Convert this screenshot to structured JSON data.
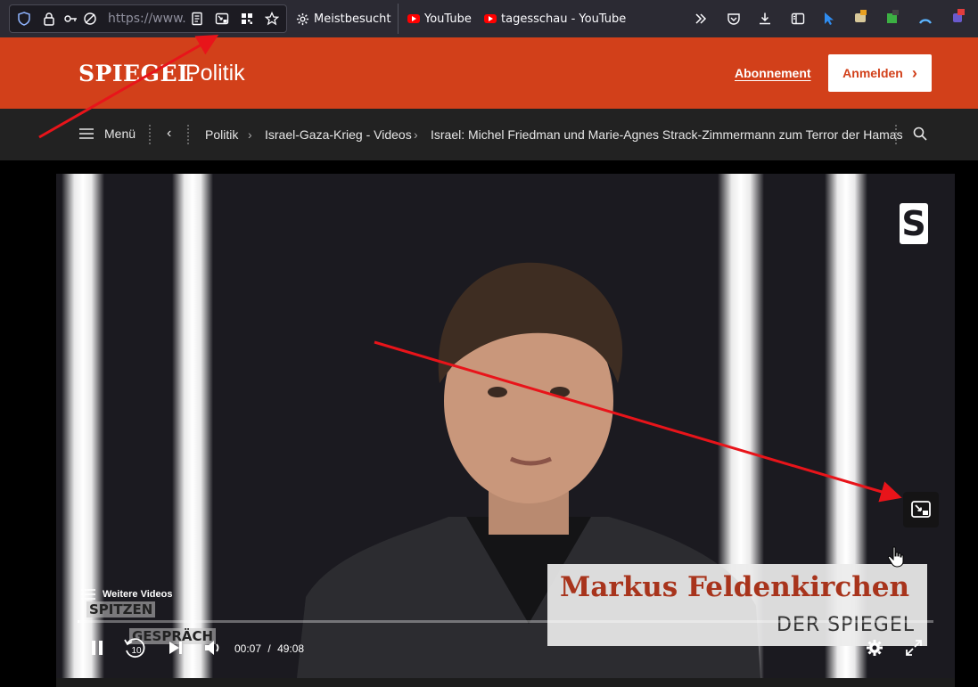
{
  "browser": {
    "url_text": "https://www.",
    "bookmarks": [
      {
        "label": "Meistbesucht",
        "icon": "gear-icon"
      },
      {
        "label": "YouTube",
        "icon": "youtube-icon"
      },
      {
        "label": "tagesschau - YouTube",
        "icon": "youtube-icon"
      }
    ]
  },
  "header": {
    "logo": "SPIEGEL",
    "section": "Politik",
    "subscribe_label": "Abonnement",
    "login_label": "Anmelden",
    "login_chevron": "›",
    "brand_color": "#d2401a"
  },
  "nav": {
    "menu_label": "Menü",
    "breadcrumb": [
      "Politik",
      "Israel-Gaza-Krieg - Videos",
      "Israel: Michel Friedman und Marie-Agnes Strack-Zimmermann zum Terror der Hamas"
    ],
    "separator": "›"
  },
  "video": {
    "lower_third_name": "Markus Feldenkirchen",
    "lower_third_org": "DER SPIEGEL",
    "show_logo_line1": "SPITZEN",
    "show_logo_line2": "GESPRÄCH",
    "channel_logo": "S",
    "more_videos_label": "Weitere Videos",
    "rewind_seconds": "10",
    "time_current": "00:07",
    "time_separator": "/",
    "time_total": "49:08",
    "progress_fraction": 0.0024
  }
}
